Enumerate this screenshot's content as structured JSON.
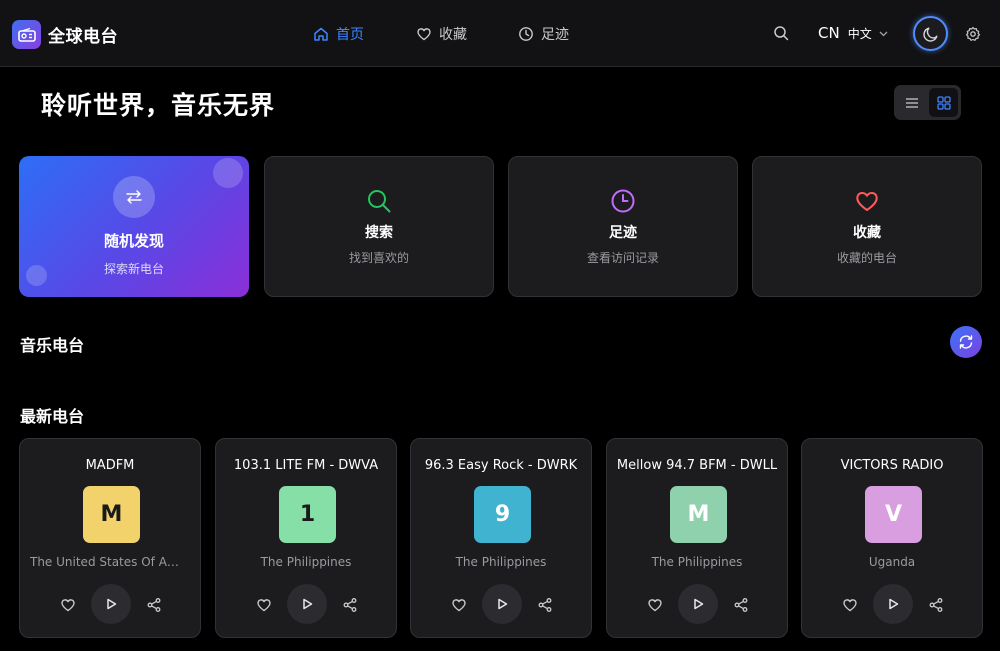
{
  "app": {
    "title": "全球电台"
  },
  "nav": {
    "home": "首页",
    "favorites": "收藏",
    "history": "足迹"
  },
  "lang": {
    "code": "CN",
    "name": "中文"
  },
  "hero": {
    "title": "聆听世界，音乐无界"
  },
  "features": [
    {
      "title": "随机发现",
      "subtitle": "探索新电台"
    },
    {
      "title": "搜索",
      "subtitle": "找到喜欢的",
      "color": "#22c55e"
    },
    {
      "title": "足迹",
      "subtitle": "查看访问记录",
      "color": "#c26bff"
    },
    {
      "title": "收藏",
      "subtitle": "收藏的电台",
      "color": "#ff5a5a"
    }
  ],
  "sections": {
    "music": "音乐电台",
    "latest": "最新电台"
  },
  "stations": [
    {
      "name": "MADFM",
      "letter": "M",
      "country": "The United States Of America",
      "color": "#f2d36b"
    },
    {
      "name": "103.1 LITE FM - DWVA",
      "letter": "1",
      "country": "The Philippines",
      "color": "#86dfa6"
    },
    {
      "name": "96.3 Easy Rock - DWRK",
      "letter": "9",
      "country": "The Philippines",
      "color": "#3fb3cf"
    },
    {
      "name": "Mellow 94.7 BFM - DWLL",
      "letter": "M",
      "country": "The Philippines",
      "color": "#8fd1ad"
    },
    {
      "name": "VICTORS RADIO",
      "letter": "V",
      "country": "Uganda",
      "color": "#d99ee0"
    }
  ],
  "colors": {
    "accent": "#3d86ff"
  },
  "icons": {
    "logo": "radio-icon",
    "home": "home-icon",
    "favorites": "heart-icon",
    "history": "clock-icon",
    "search": "search-icon",
    "theme": "moon-icon",
    "settings": "gear-icon"
  }
}
